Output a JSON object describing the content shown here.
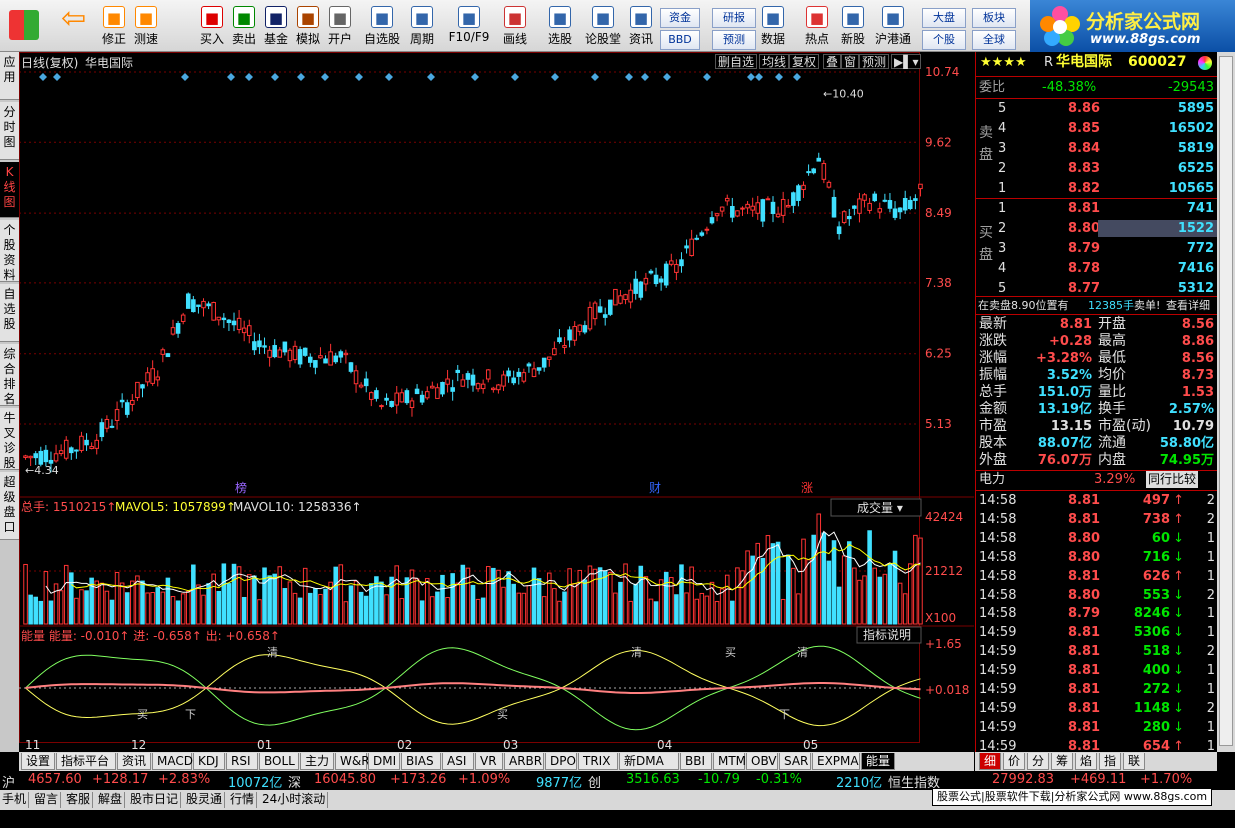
{
  "toolbar": {
    "buttons": [
      {
        "label": "修正",
        "icon": "up-down-arrows"
      },
      {
        "label": "测速",
        "icon": "clock"
      },
      {
        "label": "买入",
        "icon": "buy"
      },
      {
        "label": "卖出",
        "icon": "sell"
      },
      {
        "label": "基金",
        "icon": "fund"
      },
      {
        "label": "模拟",
        "icon": "hammer"
      },
      {
        "label": "开户",
        "icon": "lock"
      },
      {
        "label": "自选股",
        "icon": "star-list"
      },
      {
        "label": "周期",
        "icon": "clock-period"
      },
      {
        "label": "F10/F9",
        "icon": "f10"
      },
      {
        "label": "画线",
        "icon": "pencil"
      },
      {
        "label": "选股",
        "icon": "select"
      },
      {
        "label": "论股堂",
        "icon": "discuss"
      },
      {
        "label": "资讯",
        "icon": "news"
      },
      {
        "label": "数据",
        "icon": "pe-data"
      },
      {
        "label": "热点",
        "icon": "hot"
      },
      {
        "label": "新股",
        "icon": "ipo"
      },
      {
        "label": "沪港通",
        "icon": "sse-hke"
      }
    ],
    "small": [
      "资金",
      "BBD",
      "研报",
      "预测",
      "大盘",
      "个股",
      "板块",
      "全球"
    ]
  },
  "logo": {
    "title": "分析家公式网",
    "url": "www.88gs.com"
  },
  "left_tabs": [
    "应用",
    "分时图",
    "K线图",
    "个股资料",
    "自选股",
    "综合排名",
    "牛叉诊股",
    "超级盘口"
  ],
  "chart": {
    "header": {
      "period": "日线(复权)",
      "name": "华电国际"
    },
    "tools": [
      "删自选",
      "均线",
      "复权",
      "叠",
      "窗",
      "预测"
    ],
    "price_axis": [
      "10.74",
      "9.62",
      "8.49",
      "7.38",
      "6.25",
      "5.13"
    ],
    "high_label": "10.40",
    "low_label": "4.34",
    "markers": [
      {
        "text": "榜",
        "color": "#9966ff"
      },
      {
        "text": "财",
        "color": "#3366ff"
      },
      {
        "text": "涨",
        "color": "#ff3333"
      }
    ],
    "volume": {
      "label": "总手",
      "total": "1510215",
      "ma5_label": "MAVOL5:",
      "ma5": "1057899",
      "ma10_label": "MAVOL10:",
      "ma10": "1258336",
      "select": "成交量",
      "axis": [
        "42424",
        "21212",
        "X100"
      ]
    },
    "energy": {
      "title": "能量",
      "name": "能量:",
      "value": "-0.010",
      "in_label": "进:",
      "in": "-0.658",
      "out_label": "出:",
      "out": "+0.658",
      "button": "指标说明",
      "axis": [
        "+1.65",
        "+0.018"
      ],
      "annotations": [
        "下",
        "清",
        "买",
        "清",
        "买",
        "买",
        "下",
        "清"
      ]
    },
    "x_axis": [
      "11",
      "12",
      "01",
      "02",
      "03",
      "04",
      "05"
    ]
  },
  "quote": {
    "stars": "★★★★",
    "code_label": "R",
    "name": "华电国际",
    "code": "600027",
    "weibi_label": "委比",
    "weibi": "-48.38%",
    "weicha": "-29543",
    "sell_label": "卖盘",
    "buy_label": "买盘",
    "asks": [
      {
        "lv": "5",
        "price": "8.86",
        "vol": "5895"
      },
      {
        "lv": "4",
        "price": "8.85",
        "vol": "16502"
      },
      {
        "lv": "3",
        "price": "8.84",
        "vol": "5819"
      },
      {
        "lv": "2",
        "price": "8.83",
        "vol": "6525"
      },
      {
        "lv": "1",
        "price": "8.82",
        "vol": "10565"
      }
    ],
    "bids": [
      {
        "lv": "1",
        "price": "8.81",
        "vol": "741"
      },
      {
        "lv": "2",
        "price": "8.80",
        "vol": "1522"
      },
      {
        "lv": "3",
        "price": "8.79",
        "vol": "772"
      },
      {
        "lv": "4",
        "price": "8.78",
        "vol": "7416"
      },
      {
        "lv": "5",
        "price": "8.77",
        "vol": "5312"
      }
    ],
    "notice": {
      "pre": "在卖盘8.90位置有",
      "qty": "12385手",
      "post": "卖单!",
      "link": "查看详细"
    },
    "stats": [
      {
        "l1": "最新",
        "v1": "8.81",
        "c1": "red",
        "l2": "开盘",
        "v2": "8.56",
        "c2": "red"
      },
      {
        "l1": "涨跌",
        "v1": "+0.28",
        "c1": "red",
        "l2": "最高",
        "v2": "8.86",
        "c2": "red"
      },
      {
        "l1": "涨幅",
        "v1": "+3.28%",
        "c1": "red",
        "l2": "最低",
        "v2": "8.56",
        "c2": "red"
      },
      {
        "l1": "振幅",
        "v1": "3.52%",
        "c1": "cyan",
        "l2": "均价",
        "v2": "8.73",
        "c2": "red"
      },
      {
        "l1": "总手",
        "v1": "151.0万",
        "c1": "cyan",
        "l2": "量比",
        "v2": "1.53",
        "c2": "red"
      },
      {
        "l1": "金额",
        "v1": "13.19亿",
        "c1": "cyan",
        "l2": "换手",
        "v2": "2.57%",
        "c2": "cyan"
      },
      {
        "l1": "市盈",
        "v1": "13.15",
        "c1": "white",
        "l2": "市盈(动)",
        "v2": "10.79",
        "c2": "white"
      },
      {
        "l1": "股本",
        "v1": "88.07亿",
        "c1": "cyan",
        "l2": "流通",
        "v2": "58.80亿",
        "c2": "cyan"
      },
      {
        "l1": "外盘",
        "v1": "76.07万",
        "c1": "red",
        "l2": "内盘",
        "v2": "74.95万",
        "c2": "green"
      }
    ],
    "sector": {
      "name": "电力",
      "pct": "3.29%",
      "link": "同行比较"
    },
    "ticks": [
      {
        "t": "14:58",
        "p": "8.81",
        "v": "497",
        "d": "up",
        "n": "2"
      },
      {
        "t": "14:58",
        "p": "8.81",
        "v": "738",
        "d": "up",
        "n": "2"
      },
      {
        "t": "14:58",
        "p": "8.80",
        "v": "60",
        "d": "down",
        "n": "1"
      },
      {
        "t": "14:58",
        "p": "8.80",
        "v": "716",
        "d": "down",
        "n": "1"
      },
      {
        "t": "14:58",
        "p": "8.81",
        "v": "626",
        "d": "up",
        "n": "1"
      },
      {
        "t": "14:58",
        "p": "8.80",
        "v": "553",
        "d": "down",
        "n": "2"
      },
      {
        "t": "14:58",
        "p": "8.79",
        "v": "8246",
        "d": "down",
        "n": "1"
      },
      {
        "t": "14:59",
        "p": "8.81",
        "v": "5306",
        "d": "down",
        "n": "1"
      },
      {
        "t": "14:59",
        "p": "8.81",
        "v": "518",
        "d": "down",
        "n": "2"
      },
      {
        "t": "14:59",
        "p": "8.81",
        "v": "400",
        "d": "down",
        "n": "1"
      },
      {
        "t": "14:59",
        "p": "8.81",
        "v": "272",
        "d": "down",
        "n": "1"
      },
      {
        "t": "14:59",
        "p": "8.81",
        "v": "1148",
        "d": "down",
        "n": "2"
      },
      {
        "t": "14:59",
        "p": "8.81",
        "v": "280",
        "d": "down",
        "n": "1"
      },
      {
        "t": "14:59",
        "p": "8.81",
        "v": "654",
        "d": "up",
        "n": "1"
      }
    ]
  },
  "bottom_tabs": [
    "设置",
    "指标平台",
    "资讯",
    "MACD",
    "KDJ",
    "RSI",
    "BOLL",
    "主力",
    "W&R",
    "DMI",
    "BIAS",
    "ASI",
    "VR",
    "ARBR",
    "DPO",
    "TRIX",
    "新DMA",
    "BBI",
    "MTM",
    "OBV",
    "SAR",
    "EXPMA",
    "能量"
  ],
  "right_tabs": [
    "细",
    "价",
    "分",
    "筹",
    "焰",
    "指",
    "联"
  ],
  "status": {
    "sh": {
      "label": "沪",
      "idx": "4657.60",
      "chg": "+128.17",
      "pct": "+2.83%",
      "amt": "10072亿"
    },
    "sz": {
      "label": "深",
      "idx": "16045.80",
      "chg": "+173.26",
      "pct": "+1.09%",
      "amt": "9877亿"
    },
    "cy": {
      "label": "创",
      "idx": "3516.63",
      "chg": "-10.79",
      "pct": "-0.31%",
      "amt": "2210亿"
    },
    "hs": {
      "label": "恒生指数",
      "idx": "27992.83",
      "chg": "+469.11",
      "pct": "+1.70%"
    }
  },
  "status2": [
    "手机",
    "留言",
    "客服",
    "解盘",
    "股市日记",
    "股灵通",
    "行情",
    "24小时滚动"
  ],
  "promo": "股票公式|股票软件下载|分析家公式网 www.88gs.com",
  "colors": {
    "up": "#ff3333",
    "down": "#40e0ff",
    "grid": "#7a0000",
    "ma5": "#ffffff",
    "ma10": "#ffff00"
  }
}
